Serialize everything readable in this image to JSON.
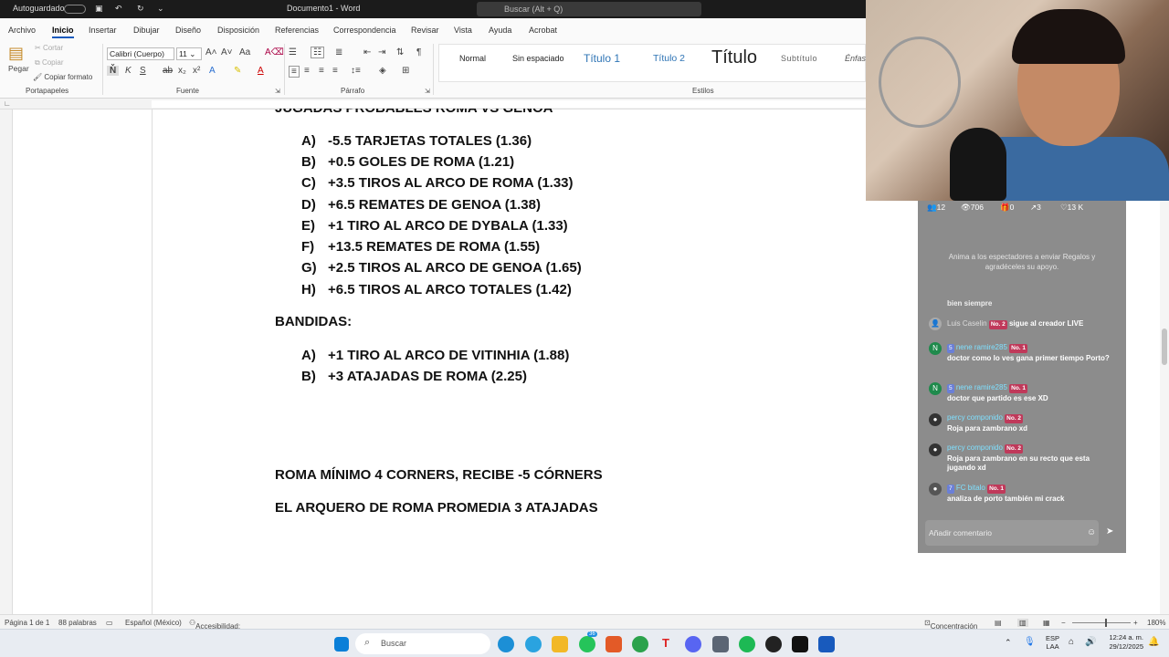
{
  "titlebar": {
    "autosave": "Autoguardado",
    "docname": "Documento1 - Word",
    "search": "Buscar (Alt + Q)"
  },
  "tabs": [
    "Archivo",
    "Inicio",
    "Insertar",
    "Dibujar",
    "Diseño",
    "Disposición",
    "Referencias",
    "Correspondencia",
    "Revisar",
    "Vista",
    "Ayuda",
    "Acrobat"
  ],
  "ribbon": {
    "paste": "Pegar",
    "cut": "Cortar",
    "copy": "Copiar",
    "format_painter": "Copiar formato",
    "font_name": "Calibri (Cuerpo)",
    "font_size": "11",
    "groups": {
      "clipboard": "Portapapeles",
      "font": "Fuente",
      "paragraph": "Párrafo",
      "styles": "Estilos"
    },
    "styles": [
      "Normal",
      "Sin espaciado",
      "Título 1",
      "Título 2",
      "Título",
      "Subtítulo",
      "Énfas"
    ]
  },
  "document": {
    "heading_partial": "JUGADAS PROBABLES ROMA VS GENOA",
    "picks": [
      {
        "letter": "A)",
        "text": "-5.5 TARJETAS TOTALES (1.36)"
      },
      {
        "letter": "B)",
        "text": "+0.5 GOLES DE ROMA (1.21)"
      },
      {
        "letter": "C)",
        "text": "+3.5 TIROS AL ARCO DE ROMA (1.33)"
      },
      {
        "letter": "D)",
        "text": "+6.5 REMATES DE GENOA (1.38)"
      },
      {
        "letter": "E)",
        "text": "+1 TIRO AL ARCO DE DYBALA (1.33)"
      },
      {
        "letter": "F)",
        "text": "+13.5 REMATES DE ROMA (1.55)"
      },
      {
        "letter": "G)",
        "text": "+2.5 TIROS AL ARCO DE GENOA (1.65)"
      },
      {
        "letter": "H)",
        "text": "+6.5 TIROS AL ARCO TOTALES (1.42)"
      }
    ],
    "bandidas_title": "BANDIDAS:",
    "bandidas": [
      {
        "letter": "A)",
        "text": "+1 TIRO AL ARCO DE VITINHIA (1.88)"
      },
      {
        "letter": "B)",
        "text": "+3 ATAJADAS DE ROMA (2.25)"
      }
    ],
    "note1": "ROMA MÍNIMO 4 CORNERS, RECIBE -5 CÓRNERS",
    "note2": "EL ARQUERO DE ROMA PROMEDIA 3 ATAJADAS"
  },
  "status": {
    "page": "Página 1 de 1",
    "words": "88 palabras",
    "lang": "Español (México)",
    "access": "Accesibilidad: todo correcto",
    "focus": "Concentración",
    "zoom": "180%"
  },
  "taskbar": {
    "search": "Buscar",
    "lang1": "ESP",
    "lang2": "LAA",
    "time": "12:24 a. m.",
    "date": "29/12/2025",
    "badge": "36"
  },
  "live": {
    "stats": {
      "members": "12",
      "viewers": "706",
      "gifts": "0",
      "shares": "3",
      "likes": "13 K"
    },
    "hint": "Anima a los espectadores a enviar Regalos y agradéceles su apoyo.",
    "prev_text": "bien siempre",
    "comments": [
      {
        "initial": "",
        "user": "Luis Caselin",
        "level": "",
        "rank": "No. 2",
        "text": "sigue al creador LIVE",
        "inline": true
      },
      {
        "initial": "N",
        "user": "nene ramire285",
        "level": "5",
        "rank": "No. 1",
        "text": "doctor como lo ves gana primer tiempo Porto?"
      },
      {
        "initial": "N",
        "user": "nene ramire285",
        "level": "5",
        "rank": "No. 1",
        "text": "doctor que partido es ese XD"
      },
      {
        "initial": "",
        "user": "percy componido",
        "level": "",
        "rank": "No. 2",
        "text": "Roja para zambrano xd"
      },
      {
        "initial": "",
        "user": "percy componido",
        "level": "",
        "rank": "No. 2",
        "text": "Roja para zambrano en su recto que esta jugando xd"
      },
      {
        "initial": "",
        "user": "FC bitalo",
        "level": "7",
        "rank": "No. 1",
        "text": "analiza de porto también mi crack"
      }
    ],
    "comment_placeholder": "Añadir comentario"
  },
  "colors": {
    "word_blue": "#185abd",
    "badge": "#c0395a"
  }
}
